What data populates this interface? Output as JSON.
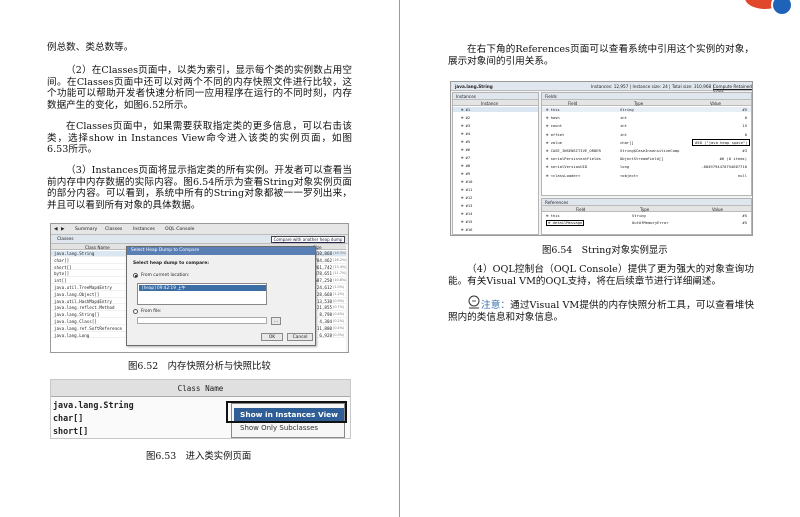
{
  "left_page": {
    "p1": "例总数、类总数等。",
    "p2": "（2）在Classes页面中，以类为索引，显示每个类的实例数占用空间。在Classes页面中还可以对两个不同的内存快照文件进行比较，这个功能可以帮助开发者快速分析同一应用程序在运行的不同时刻，内存数据产生的变化，如图6.52所示。",
    "p3": "在Classes页面中，如果需要获取指定类的更多信息，可以右击该类，选择show in Instances View命令进入该类的实例页面，如图6.53所示。",
    "p4": "（3）Instances页面将显示指定类的所有实例。开发者可以查看当前内存中内存数据的实际内容。图6.54所示为查看String对象实例页面的部分内容。可以看到，系统中所有的String对象都被一一罗列出来，并且可以看到所有对象的具体数据。",
    "caption_52": "图6.52　内存快照分析与快照比较",
    "caption_53": "图6.53　进入类实例页面"
  },
  "right_page": {
    "p1": "在右下角的References页面可以查看系统中引用这个实例的对象，展示对象间的引用关系。",
    "caption_54": "图6.54　String对象实例显示",
    "p2": "（4）OQL控制台（OQL Console）提供了更为强大的对象查询功能。有关Visual VM的OQL支持，将在后续章节进行详细阐述。",
    "note_label": "注意：",
    "note_text": "通过Visual VM提供的内存快照分析工具，可以查看堆快照内的类信息和对象信息。"
  },
  "fig52": {
    "toolbar": [
      "Summary",
      "Classes",
      "Instances",
      "OQL Console"
    ],
    "tab": "Classes",
    "compare_link": "Compare with another heap dump",
    "col_name": "Class Name",
    "col_size": "Size",
    "rows": [
      {
        "name": "java.lang.String",
        "size": "310,868",
        "pct": "(16.3%)"
      },
      {
        "name": "char[]",
        "size": "784,462",
        "pct": "(16.2%)"
      },
      {
        "name": "short[]",
        "size": "261,742",
        "pct": "(13.4%)"
      },
      {
        "name": "byte[]",
        "size": "478,651",
        "pct": "(11.7%)"
      },
      {
        "name": "int[]",
        "size": "587,250",
        "pct": "(10.8%)"
      },
      {
        "name": "java.util.TreeMap$Entry",
        "size": "24,612",
        "pct": "(1.0%)"
      },
      {
        "name": "java.lang.Object[]",
        "size": "28,668",
        "pct": "(1.2%)"
      },
      {
        "name": "java.util.HashMap$Entry",
        "size": "13,530",
        "pct": "(0.9%)"
      },
      {
        "name": "java.lang.reflect.Method",
        "size": "21,855",
        "pct": "(0.7%)"
      },
      {
        "name": "java.lang.String[]",
        "size": "8,798",
        "pct": "(0.4%)"
      },
      {
        "name": "java.lang.Class[]",
        "size": "4,304",
        "pct": "(0.2%)"
      },
      {
        "name": "java.lang.ref.SoftReference",
        "size": "11,880",
        "pct": "(0.4%)"
      },
      {
        "name": "java.lang.Long",
        "size": "6,928",
        "pct": "(0.3%)"
      }
    ],
    "dialog": {
      "title": "Select Heap Dump to Compare",
      "prompt": "Select heap dump to compare:",
      "from_project": "From current location:",
      "selected": "[heap] 09:42:19 上午",
      "from_file": "From file:",
      "ok": "OK",
      "cancel": "Cancel"
    }
  },
  "fig53": {
    "header": "Class Name",
    "rows": [
      "java.lang.String",
      "char[]",
      "short[]"
    ],
    "menu_primary": "Show in Instances View",
    "menu_secondary": "Show Only Subclasses"
  },
  "fig54": {
    "class": "java.lang.String",
    "summary": "Instances: 12,957 | Instance size: 24 | Total size: 310,968 |",
    "retained_link": "Compute Retained Sizes",
    "instances_title": "Instances",
    "fields_title": "Fields",
    "instance_col": "Instance",
    "field_cols": [
      "Field",
      "Type",
      "Value"
    ],
    "instances": [
      "#1",
      "#2",
      "#3",
      "#4",
      "#5",
      "#6",
      "#7",
      "#8",
      "#9",
      "#10",
      "#11",
      "#12",
      "#13",
      "#14",
      "#15",
      "#16"
    ],
    "fields": [
      {
        "f": "this",
        "t": "String",
        "v": "#5"
      },
      {
        "f": "hash",
        "t": "int",
        "v": "0"
      },
      {
        "f": "count",
        "t": "int",
        "v": "15"
      },
      {
        "f": "offset",
        "t": "int",
        "v": "0"
      },
      {
        "f": "value",
        "t": "char[]",
        "v": "#58 (\"java heap space\")"
      },
      {
        "f": "CASE_INSENSITIVE_ORDER",
        "t": "String$CaseInsensitiveComp",
        "v": "#3"
      },
      {
        "f": "serialPersistentFields",
        "t": "ObjectStreamField[]",
        "v": "#6 (0 items)"
      },
      {
        "f": "serialVersionUID",
        "t": "long",
        "v": "-6849794470754667710"
      },
      {
        "f": "<classLoader>",
        "t": "<object>",
        "v": "null"
      }
    ],
    "references_title": "References",
    "ref_cols": [
      "Field",
      "Type",
      "Value"
    ],
    "references": [
      {
        "f": "this",
        "t": "String",
        "v": "#5"
      },
      {
        "f": "detailMessage",
        "t": "OutOfMemoryError",
        "v": "#5"
      }
    ]
  },
  "colors": {
    "accent_badge": "#e0472c",
    "accent_badge2": "#1e63b8",
    "selection": "#3a6ea5",
    "menu_highlight": "#2f5d95"
  }
}
